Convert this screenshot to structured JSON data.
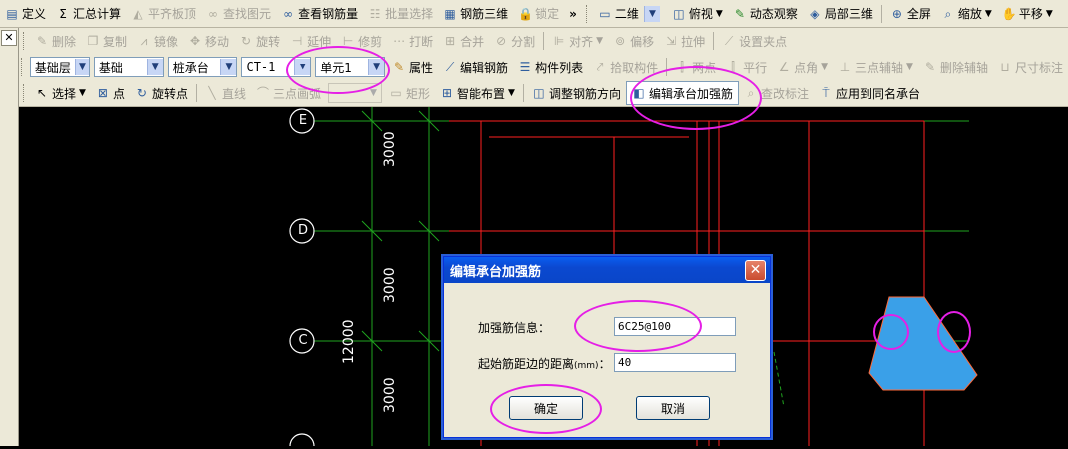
{
  "toolbar1": {
    "items": [
      {
        "label": "定义",
        "icon": "define-icon"
      },
      {
        "label": "汇总计算",
        "icon": "sigma-icon"
      },
      {
        "label": "平齐板顶",
        "icon": "align-top-icon",
        "disabled": true
      },
      {
        "label": "查找图元",
        "icon": "binoculars-icon",
        "disabled": true
      },
      {
        "label": "查看钢筋量",
        "icon": "glasses-icon"
      },
      {
        "label": "批量选择",
        "icon": "batch-select-icon",
        "disabled": true
      },
      {
        "label": "钢筋三维",
        "icon": "rebar-3d-icon"
      },
      {
        "label": "锁定",
        "icon": "lock-icon",
        "disabled": true
      }
    ],
    "more": "»",
    "view2d": "二维",
    "topview": "俯视",
    "dynamic_view": "动态观察",
    "local_3d": "局部三维",
    "fullscreen": "全屏",
    "zoom": "缩放",
    "pan": "平移"
  },
  "toolbar2": {
    "items": [
      "删除",
      "复制",
      "镜像",
      "移动",
      "旋转",
      "延伸",
      "修剪",
      "打断",
      "合并",
      "分割",
      "对齐",
      "偏移",
      "拉伸",
      "设置夹点"
    ]
  },
  "toolbar3": {
    "combos": [
      "基础层",
      "基础",
      "桩承台",
      "CT-1",
      "单元1"
    ],
    "items": [
      {
        "label": "属性",
        "disabled": false
      },
      {
        "label": "编辑钢筋",
        "disabled": false
      },
      {
        "label": "构件列表",
        "disabled": false
      },
      {
        "label": "拾取构件",
        "disabled": true
      },
      {
        "label": "两点",
        "disabled": true
      },
      {
        "label": "平行",
        "disabled": true
      },
      {
        "label": "点角",
        "disabled": true
      },
      {
        "label": "三点辅轴",
        "disabled": true
      },
      {
        "label": "删除辅轴",
        "disabled": true
      },
      {
        "label": "尺寸标注",
        "disabled": true
      }
    ]
  },
  "toolbar4": {
    "select": "选择",
    "point": "点",
    "rotate_point": "旋转点",
    "line": "直线",
    "arc": "三点画弧",
    "rect": "矩形",
    "smart_layout": "智能布置",
    "adjust_dir": "调整钢筋方向",
    "edit_cap_rebar": "编辑承台加强筋",
    "find_anno": "查改标注",
    "apply_same": "应用到同名承台"
  },
  "drawing": {
    "axes": [
      "E",
      "D",
      "C"
    ],
    "spans": [
      "3000",
      "3000",
      "3000"
    ],
    "total": "12000"
  },
  "dialog": {
    "title": "编辑承台加强筋",
    "rebar_label": "加强筋信息：",
    "rebar_value": "6C25@100",
    "dist_label": "起始筋距边的距离",
    "dist_unit": "(mm)",
    "dist_colon": "：",
    "dist_value": "40",
    "ok": "确定",
    "cancel": "取消"
  },
  "colors": {
    "highlight": "#e51fe6",
    "grid_red": "#ff2020",
    "grid_green": "#1fa51f",
    "cap_blue": "#3aa0e8"
  }
}
